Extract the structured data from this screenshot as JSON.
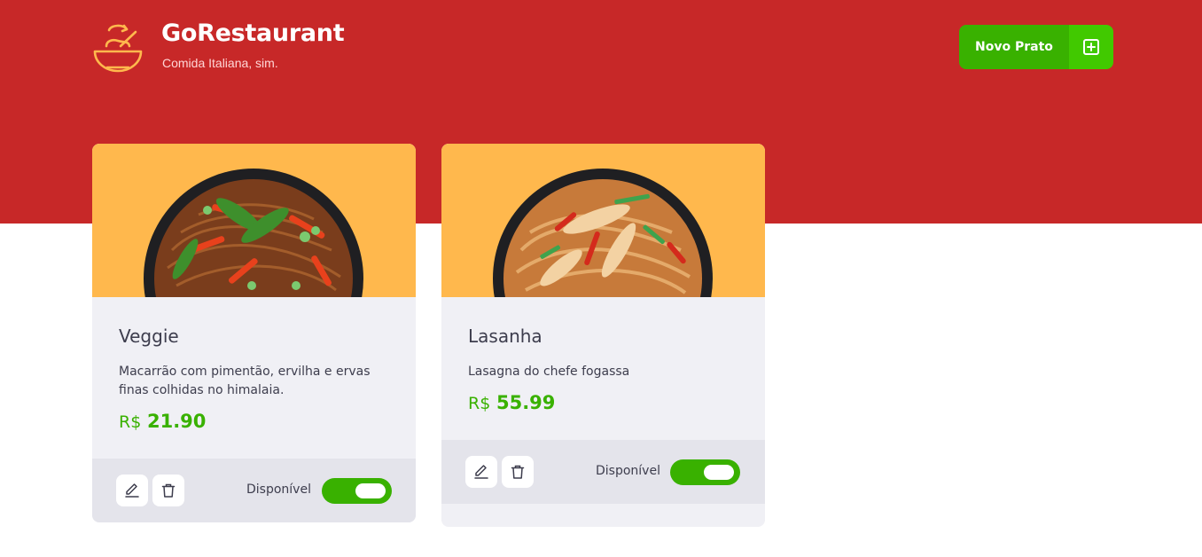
{
  "header": {
    "brand_title": "GoRestaurant",
    "brand_subtitle": "Comida Italiana, sim.",
    "new_dish_label": "Novo Prato",
    "logo_icon": "soup-bowl-icon",
    "new_dish_icon": "plus-square-icon"
  },
  "colors": {
    "header_bg": "#c72828",
    "accent_green": "#39b100",
    "card_image_bg": "#ffb84d",
    "card_bg": "#f0f0f5",
    "card_footer_bg": "#e4e4eb"
  },
  "dishes": [
    {
      "name": "Veggie",
      "description": "Macarrão com pimentão, ervilha e ervas finas colhidas no himalaia.",
      "currency": "R$",
      "price": "21.90",
      "availability_label": "Disponível",
      "available": true
    },
    {
      "name": "Lasanha",
      "description": "Lasagna do chefe fogassa",
      "currency": "R$",
      "price": "55.99",
      "availability_label": "Disponível",
      "available": true
    }
  ]
}
